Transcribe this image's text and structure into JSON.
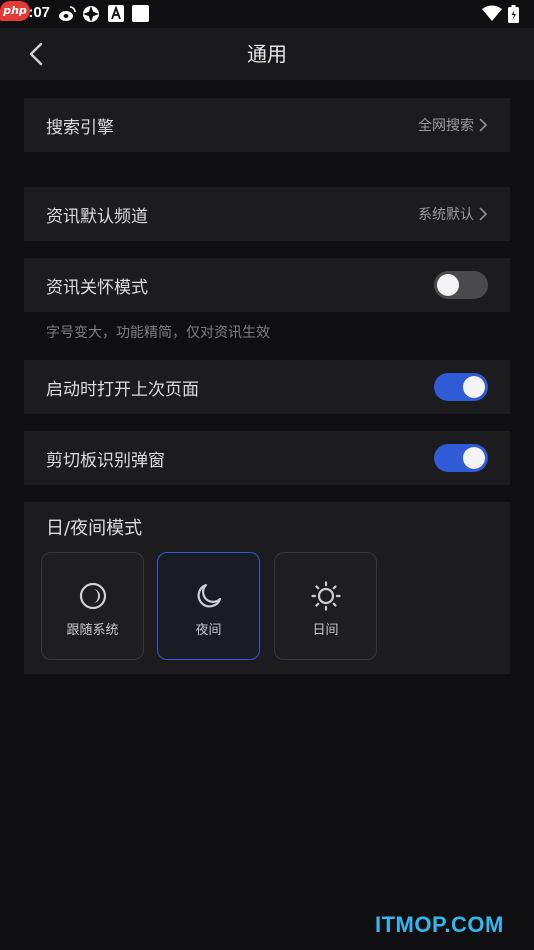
{
  "status_bar": {
    "time": "5:07",
    "php_logo": "php"
  },
  "header": {
    "title": "通用"
  },
  "rows": {
    "search_engine": {
      "label": "搜索引擎",
      "value": "全网搜索"
    },
    "news_channel": {
      "label": "资讯默认频道",
      "value": "系统默认"
    },
    "care_mode": {
      "label": "资讯关怀模式",
      "toggle": false,
      "hint": "字号变大，功能精简，仅对资讯生效"
    },
    "reopen_last": {
      "label": "启动时打开上次页面",
      "toggle": true
    },
    "clipboard_popup": {
      "label": "剪切板识别弹窗",
      "toggle": true
    }
  },
  "theme": {
    "title": "日/夜间模式",
    "options": [
      {
        "label": "跟随系统",
        "icon": "follow-system-icon",
        "selected": false
      },
      {
        "label": "夜间",
        "icon": "moon-icon",
        "selected": true
      },
      {
        "label": "日间",
        "icon": "sun-icon",
        "selected": false
      }
    ]
  },
  "watermark": "ITMOP.COM",
  "colors": {
    "accent": "#2f5bd6",
    "background": "#0f0f11",
    "card": "#1c1c1e",
    "watermark": "#35b6ec"
  }
}
